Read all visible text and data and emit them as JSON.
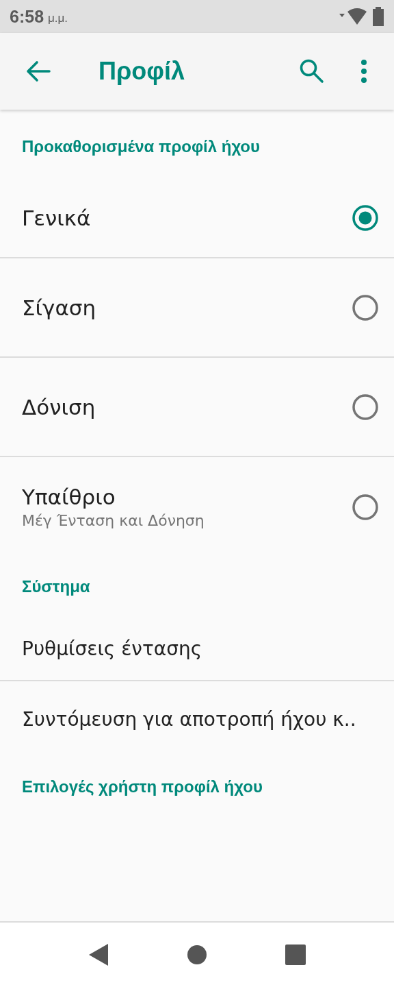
{
  "status_bar": {
    "time": "6:58",
    "period": "μ.μ."
  },
  "toolbar": {
    "title": "Προφίλ"
  },
  "sections": [
    {
      "header": "Προκαθορισμένα προφίλ ήχου",
      "items": [
        {
          "kind": "radio",
          "title": "Γενικά",
          "selected": true
        },
        {
          "kind": "radio",
          "title": "Σίγαση",
          "selected": false
        },
        {
          "kind": "radio",
          "title": "Δόνιση",
          "selected": false
        },
        {
          "kind": "radio",
          "title": "Υπαίθριο",
          "subtitle": "Μέγ Ένταση και Δόνηση",
          "selected": false
        }
      ]
    },
    {
      "header": "Σύστημα",
      "items": [
        {
          "kind": "link",
          "title": "Ρυθμίσεις έντασης"
        },
        {
          "kind": "link",
          "title": "Συντόμευση για αποτροπή ήχου κ.."
        }
      ]
    },
    {
      "header": "Επιλογές χρήστη προφίλ ήχου"
    }
  ]
}
